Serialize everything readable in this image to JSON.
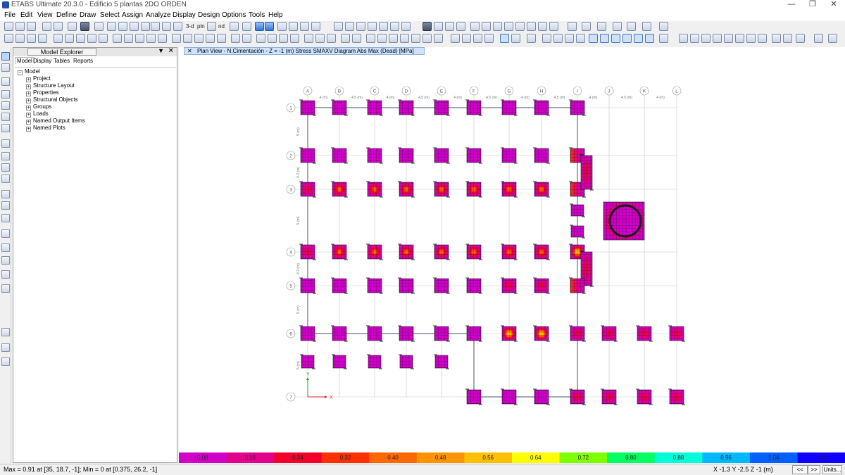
{
  "window": {
    "title": "ETABS Ultimate 20.3.0 - Edificio 5 plantas 2DO ORDEN",
    "min_glyph": "—",
    "max_glyph": "❐",
    "close_glyph": "✕"
  },
  "menu": [
    "File",
    "Edit",
    "View",
    "Define",
    "Draw",
    "Select",
    "Assign",
    "Analyze",
    "Display",
    "Design",
    "Options",
    "Tools",
    "Help"
  ],
  "toolbar": {
    "view_3d_label": "3-d",
    "plan_label": "pln",
    "elev_label": "nd",
    "icons_row1": [
      "new-model-icon",
      "open-icon",
      "save-icon",
      "undo-icon",
      "redo-icon",
      "lock-icon",
      "run-icon",
      "zoom-in-icon",
      "zoom-out-icon",
      "pan-icon",
      "refresh-icon"
    ],
    "icons_row2": [
      "select-icon",
      "deselect-icon",
      "display-options-icon",
      "analysis-icon",
      "design-icon"
    ]
  },
  "explorer": {
    "title": "Model Explorer",
    "pin_glyph": "▼",
    "close_glyph": "✕",
    "tabs": [
      "Model",
      "Display",
      "Tables",
      "Reports"
    ],
    "root": "Model",
    "items": [
      "Project",
      "Structure Layout",
      "Properties",
      "Structural Objects",
      "Groups",
      "Loads",
      "Named Output Items",
      "Named Plots"
    ]
  },
  "view": {
    "tab_title": "Plan View - N.Cimentación - Z = -1 (m)   Stress SMAXV Diagram  Abs Max   (Dead)  [MPa]",
    "grid_columns": [
      "A",
      "B",
      "C",
      "D",
      "E",
      "F",
      "G",
      "H",
      "I",
      "J",
      "K",
      "L"
    ],
    "grid_rows": [
      "1",
      "2",
      "3",
      "4",
      "5",
      "6",
      "7"
    ],
    "spacing_labels": [
      "4 (m)",
      "4.5 (m)",
      "4 (m)",
      "4.5 (m)",
      "4 (m)",
      "4.5 (m)",
      "4 (m)",
      "4.5 (m)",
      "4 (m)",
      "4.5 (m)",
      "4 (m)"
    ],
    "row_spacing_labels": [
      "5 (m)",
      "4.2 (m)",
      "5 (m)",
      "4.2 (m)",
      "5 (m)",
      "5 (m)"
    ],
    "axis_x": "X",
    "axis_y": "Y"
  },
  "legend": {
    "values": [
      "0.08",
      "0.16",
      "0.24",
      "0.32",
      "0.40",
      "0.48",
      "0.56",
      "0.64",
      "0.72",
      "0.80",
      "0.88",
      "0.96",
      "1.04",
      "1.12"
    ],
    "colors": [
      "#d000c8",
      "#e0008c",
      "#f2002a",
      "#ff3000",
      "#ff6800",
      "#ff9400",
      "#ffc000",
      "#ffff00",
      "#80ff00",
      "#00ff60",
      "#00ffd8",
      "#00b8ff",
      "#0060ff",
      "#1000ff"
    ]
  },
  "status": {
    "left": "Max = 0.91 at [35, 18.7, -1];  Min = 0 at [0.375, 26.2, -1]",
    "coords": "X -1.3  Y -2.5  Z -1 (m)",
    "prev": "<<",
    "next": ">>",
    "units": "Units..."
  }
}
